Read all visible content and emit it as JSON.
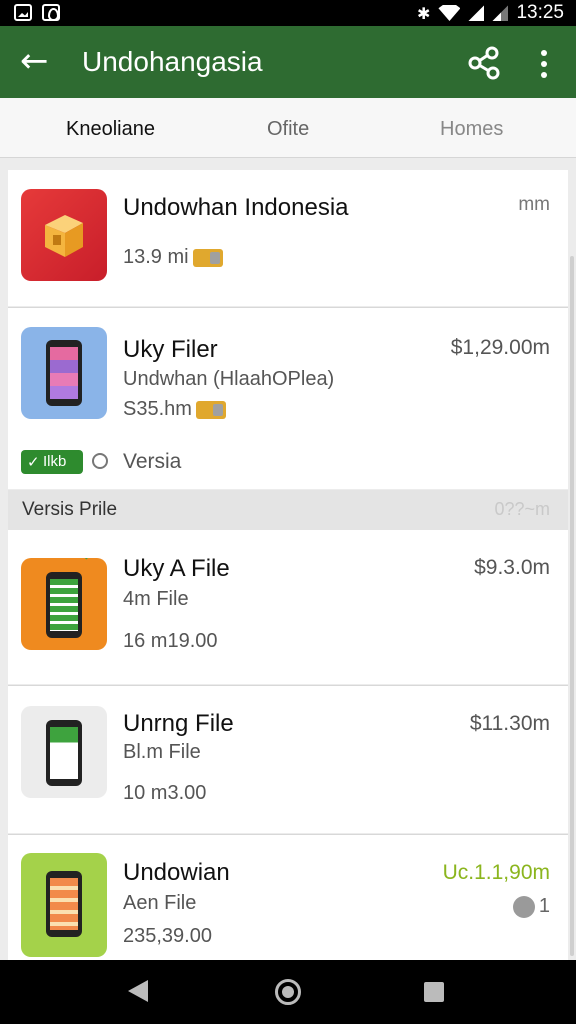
{
  "status_bar": {
    "time": "13:25"
  },
  "app_bar": {
    "title": "Undohangasia"
  },
  "tabs": [
    {
      "label": "Kneoliane"
    },
    {
      "label": "Ofite"
    },
    {
      "label": "Homes"
    }
  ],
  "featured": {
    "name": "Undowhan Indonesia",
    "size": "13.9 mi",
    "right": "mm"
  },
  "item1": {
    "name": "Uky Filer",
    "subtitle": "Undwhan (HlaahOPlea)",
    "size": "S35.hm",
    "price": "$1,29.00m",
    "badge": "Ilkb",
    "version": "Versia"
  },
  "section": {
    "label": "Versis Prile",
    "right": "0??~m"
  },
  "list": [
    {
      "name": "Uky A File",
      "subtitle": "4m File",
      "meta": "16 m19.00",
      "price": "$9.3.0m"
    },
    {
      "name": "Unrng File",
      "subtitle": "Bl.m File",
      "meta": "10 m3.00",
      "price": "$11.30m"
    },
    {
      "name": "Undowian",
      "subtitle": "Aen File",
      "meta": "235,39.00",
      "price": "Uc.1.1,90m",
      "count": "1"
    }
  ],
  "colors": {
    "app_bar": "#2e6b31",
    "accent_price": "#8bb51e"
  }
}
